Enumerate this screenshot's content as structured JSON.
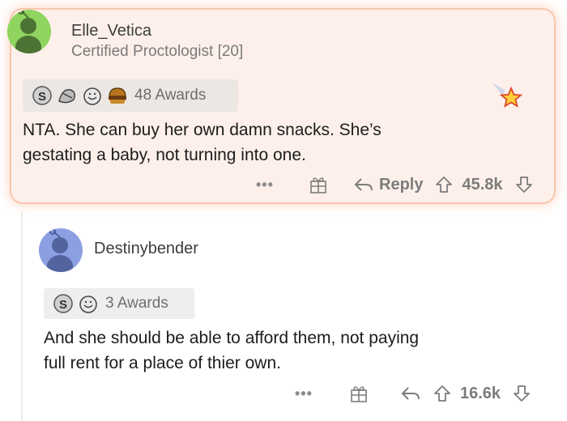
{
  "comments": [
    {
      "username": "Elle_Vetica",
      "flair": "Certified Proctologist [20]",
      "awards_label": "48 Awards",
      "award_icons": [
        "silver-award-icon",
        "wholesome-seal-icon",
        "smile-award-icon",
        "burger-award-icon"
      ],
      "body_lines": [
        "NTA. She can buy her own damn snacks. She’s",
        "gestating a baby, not turning into one."
      ],
      "actions": {
        "more": "•••",
        "reply": "Reply",
        "score": "45.8k"
      }
    },
    {
      "username": "Destinybender",
      "awards_label": "3 Awards",
      "award_icons": [
        "silver-award-icon",
        "smile-award-icon"
      ],
      "body_lines": [
        "And she should be able to afford them, not paying",
        "full rent for a place of thier own."
      ],
      "actions": {
        "more": "•••",
        "score": "16.6k"
      }
    }
  ],
  "colors": {
    "highlight_bg": "#fdf0ea",
    "highlight_border": "#f8c7ad",
    "avatar1": "#8fd45f",
    "avatar2": "#8d9fe3",
    "star": "#ffcf3a"
  }
}
